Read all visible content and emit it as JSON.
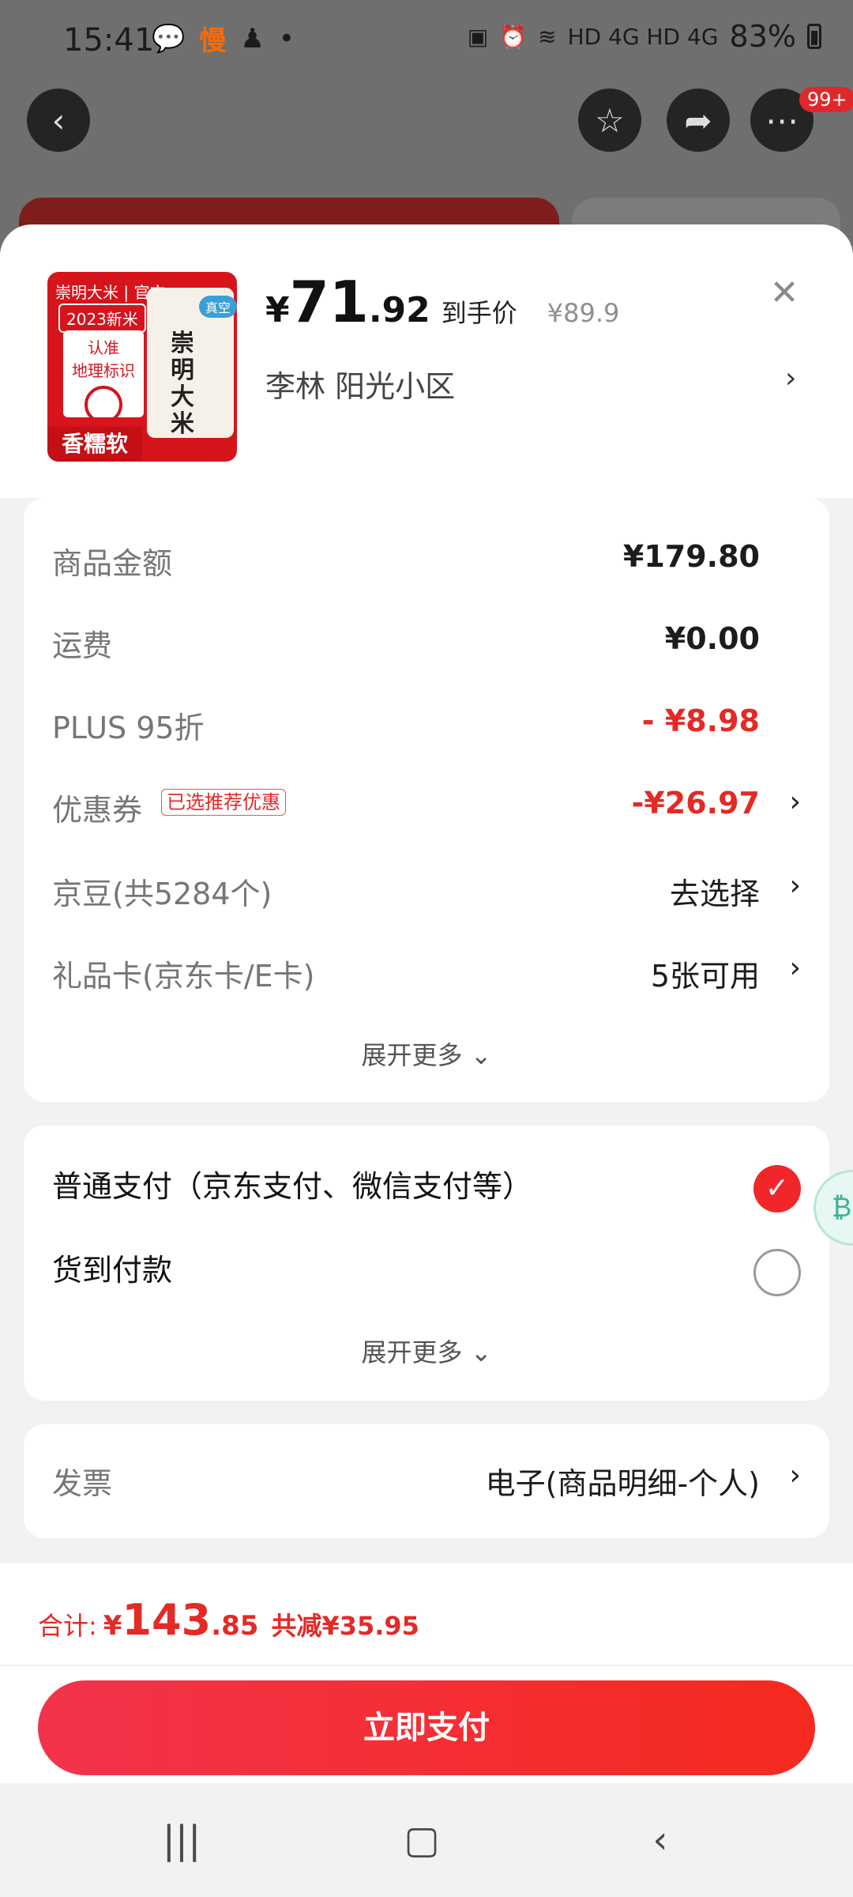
{
  "status_bar": {
    "time": "15:41",
    "left_icons": [
      "wechat-icon",
      "app-notification-icon",
      "figure-icon",
      "dot-icon"
    ],
    "network": "HD 4G HD 4G",
    "battery": "83%"
  },
  "top_nav": {
    "back_icon": "back-icon",
    "badge": "99+"
  },
  "product": {
    "image_brand": "崇明大米 | 官方",
    "image_tag": "2023新米",
    "image_geo": "认准\n地理标识",
    "image_slogan": "香糯软",
    "image_bag_text": "崇明大米",
    "image_vacuum": "真空",
    "price_currency": "¥",
    "price_int": "71",
    "price_dec": ".92",
    "price_label": "到手价",
    "original_price": "¥89.9",
    "address": "李林  阳光小区"
  },
  "summary": {
    "rows": [
      {
        "label": "商品金额",
        "value": "¥179.80"
      },
      {
        "label": "运费",
        "value": "¥0.00"
      },
      {
        "label": "PLUS 95折",
        "value": "- ¥8.98"
      },
      {
        "label": "优惠券",
        "tag": "已选推荐优惠",
        "value": "-¥26.97"
      },
      {
        "label": "京豆(共5284个)",
        "value": "去选择"
      },
      {
        "label": "礼品卡(京东卡/E卡)",
        "value": "5张可用"
      }
    ],
    "expand": "展开更多"
  },
  "payment": {
    "options": [
      {
        "label": "普通支付（京东支付、微信支付等）",
        "selected": true
      },
      {
        "label": "货到付款",
        "selected": false
      }
    ],
    "expand": "展开更多"
  },
  "invoice": {
    "label": "发票",
    "value": "电子(商品明细-个人)"
  },
  "footer": {
    "total_label": "合计:",
    "total_currency": "¥",
    "total_int": "143",
    "total_dec": ".85",
    "savings": "共减¥35.95",
    "pay_button": "立即支付"
  },
  "colors": {
    "accent_red": "#e32a27",
    "button_gradient_start": "#f2334b",
    "button_gradient_end": "#f52a1f"
  }
}
